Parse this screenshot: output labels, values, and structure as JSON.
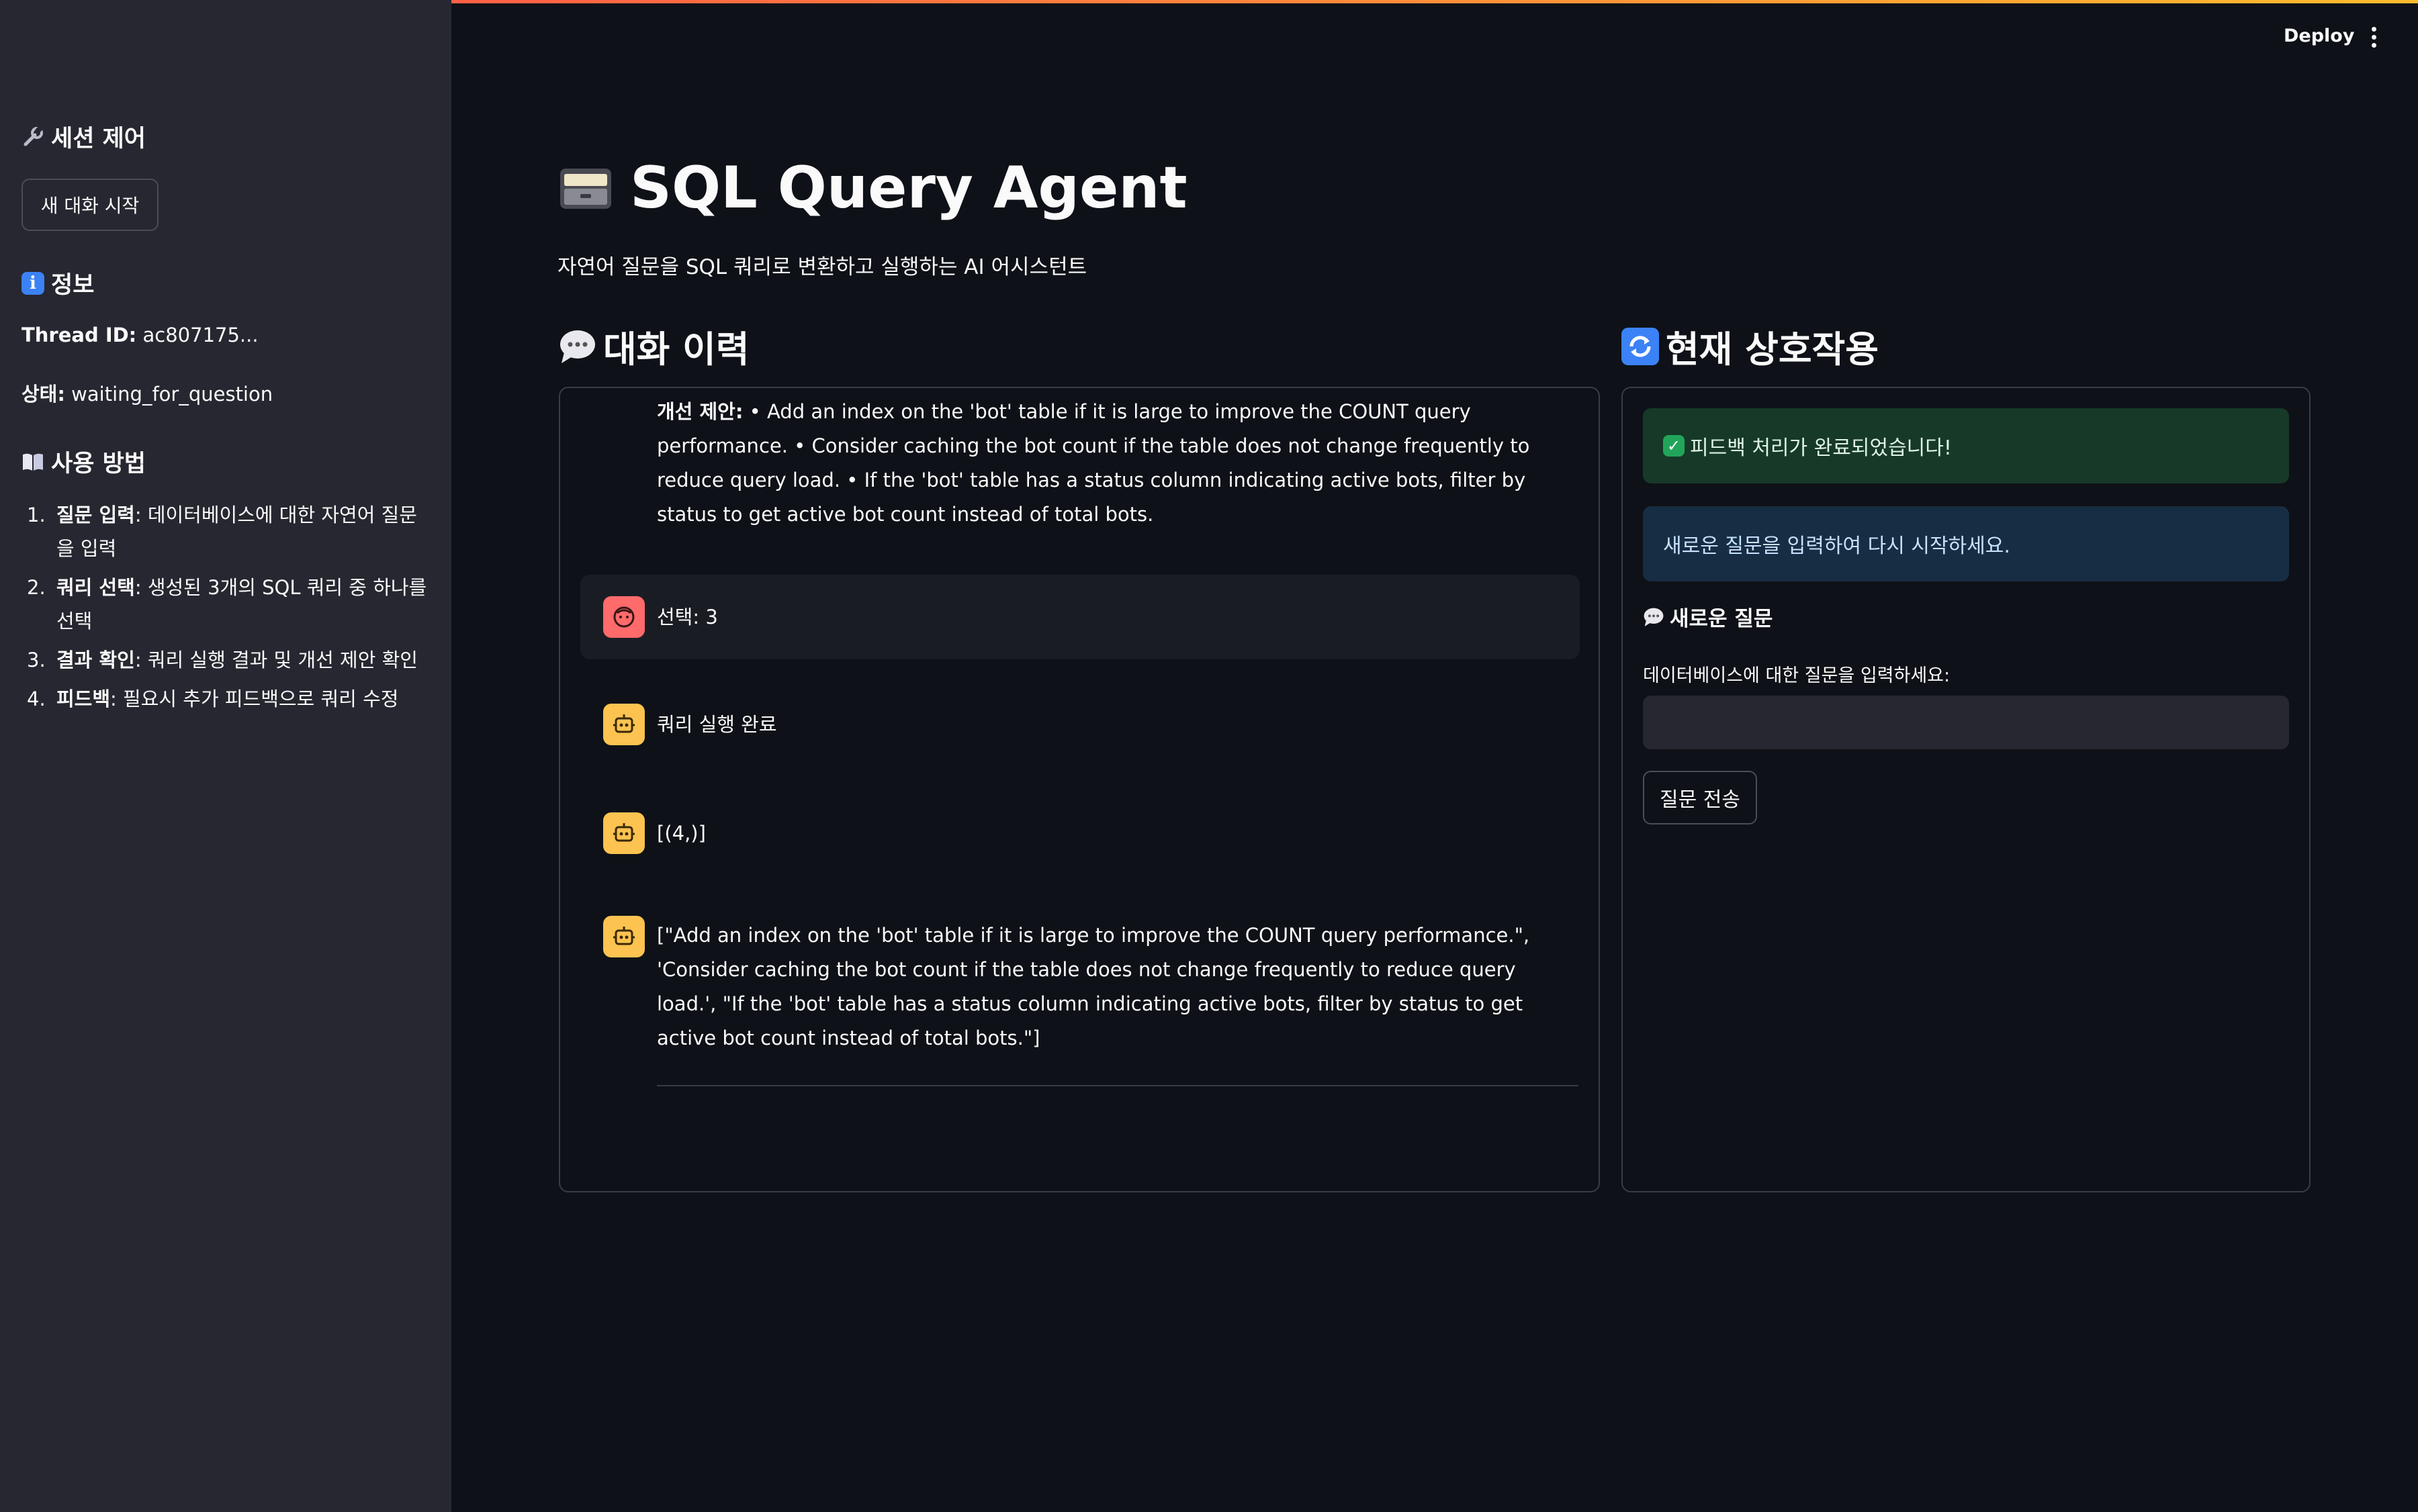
{
  "header": {
    "deploy_label": "Deploy"
  },
  "sidebar": {
    "session_heading": "세션 제어",
    "new_chat_button": "새 대화 시작",
    "info_heading": "정보",
    "thread_label": "Thread ID:",
    "thread_value": " ac807175...",
    "status_label": "상태:",
    "status_value": " waiting_for_question",
    "usage_heading": "사용 방법",
    "usage": [
      {
        "num": "1.",
        "title": "질문 입력",
        "desc": ": 데이터베이스에 대한 자연어 질문을 입력"
      },
      {
        "num": "2.",
        "title": "쿼리 선택",
        "desc": ": 생성된 3개의 SQL 쿼리 중 하나를 선택"
      },
      {
        "num": "3.",
        "title": "결과 확인",
        "desc": ": 쿼리 실행 결과 및 개선 제안 확인"
      },
      {
        "num": "4.",
        "title": "피드백",
        "desc": ": 필요시 추가 피드백으로 쿼리 수정"
      }
    ]
  },
  "main": {
    "title": "SQL Query Agent",
    "subtitle": "자연어 질문을 SQL 쿼리로 변환하고 실행하는 AI 어시스턴트",
    "history_heading": "대화 이력",
    "current_heading": "현재 상호작용"
  },
  "history": {
    "suggestion_label": "개선 제안:",
    "suggestion_text": " • Add an index on the 'bot' table if it is large to improve the COUNT query performance. • Consider caching the bot count if the table does not change frequently to reduce query load. • If the 'bot' table has a status column indicating active bots, filter by status to get active bot count instead of total bots.",
    "user_choice": "선택: 3",
    "bot_done": "쿼리 실행 완료",
    "bot_result": "[(4,)]",
    "bot_suggestions": "[\"Add an index on the 'bot' table if it is large to improve the COUNT query performance.\", 'Consider caching the bot count if the table does not change frequently to reduce query load.', \"If the 'bot' table has a status column indicating active bots, filter by status to get active bot count instead of total bots.\"]"
  },
  "current": {
    "success_text": "피드백 처리가 완료되었습니다!",
    "info_text": "새로운 질문을 입력하여 다시 시작하세요.",
    "new_question_heading": "새로운 질문",
    "input_label": "데이터베이스에 대한 질문을 입력하세요:",
    "input_value": "",
    "submit_label": "질문 전송"
  },
  "colors": {
    "background": "#0e1117",
    "sidebar": "#262730",
    "success_bg": "#173928",
    "info_bg": "#172d43",
    "user_avatar": "#ff6b6b",
    "bot_avatar": "#fcc350"
  }
}
